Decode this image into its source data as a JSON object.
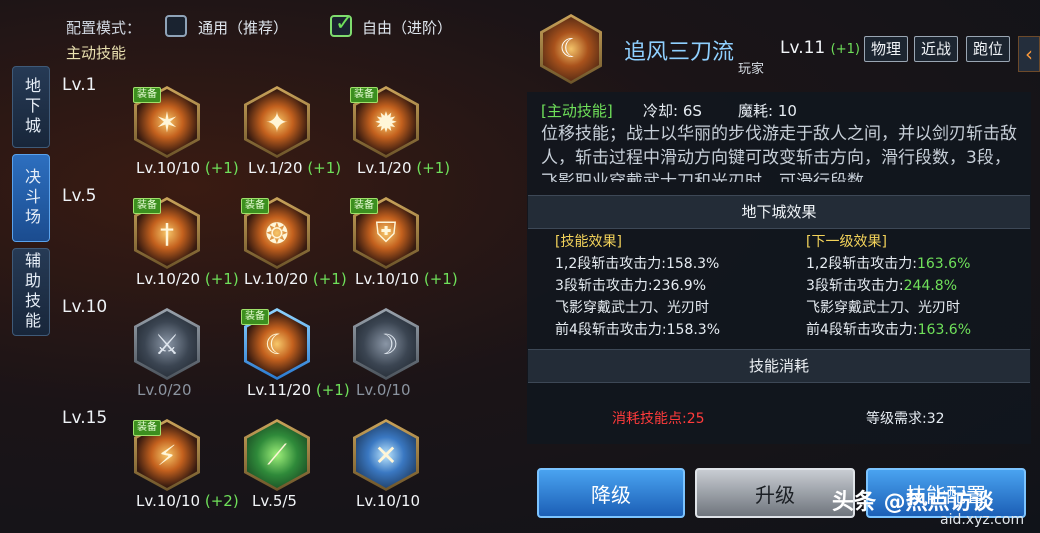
{
  "config": {
    "label": "配置模式：",
    "option_general": "通用（推荐）",
    "option_free": "自由（进阶）",
    "free_checked": true
  },
  "section_title": "主动技能",
  "tabs": [
    "地下城",
    "决斗场",
    "辅助技能"
  ],
  "levels": [
    "Lv.1",
    "Lv.5",
    "Lv.10",
    "Lv.15"
  ],
  "equip_badge": "装备",
  "skills": [
    {
      "lv": "Lv.10/10",
      "plus": "(+1)",
      "equipped": true,
      "icon": "claw-slash-icon"
    },
    {
      "lv": "Lv.1/20",
      "plus": "(+1)",
      "equipped": false,
      "icon": "sword-wave-icon"
    },
    {
      "lv": "Lv.1/20",
      "plus": "(+1)",
      "equipped": true,
      "icon": "flame-slash-icon"
    },
    {
      "lv": "Lv.10/20",
      "plus": "(+1)",
      "equipped": true,
      "icon": "sword-burst-icon"
    },
    {
      "lv": "Lv.10/20",
      "plus": "(+1)",
      "equipped": true,
      "icon": "spin-slash-icon"
    },
    {
      "lv": "Lv.10/10",
      "plus": "(+1)",
      "equipped": true,
      "icon": "shield-sword-icon"
    },
    {
      "lv": "Lv.0/20",
      "plus": "",
      "equipped": false,
      "icon": "dash-sword-icon"
    },
    {
      "lv": "Lv.11/20",
      "plus": "(+1)",
      "equipped": true,
      "icon": "triple-slash-icon"
    },
    {
      "lv": "Lv.0/10",
      "plus": "",
      "equipped": false,
      "icon": "moon-crest-icon"
    },
    {
      "lv": "Lv.10/10",
      "plus": "(+2)",
      "equipped": true,
      "icon": "warrior-strike-icon"
    },
    {
      "lv": "Lv.5/5",
      "plus": "",
      "equipped": false,
      "icon": "green-blade-icon"
    },
    {
      "lv": "Lv.10/10",
      "plus": "",
      "equipped": false,
      "icon": "cross-swords-icon"
    }
  ],
  "detail": {
    "name": "追风三刀流",
    "player": "玩家",
    "level": "Lv.11",
    "level_plus": "(+1)",
    "tags": [
      "物理",
      "近战",
      "跑位"
    ],
    "type_label": "[主动技能]",
    "cooldown": "冷却: 6S",
    "mana": "魔耗: 10",
    "description": "位移技能；战士以华丽的步伐游走于敌人之间，并以剑刃斩击敌人，斩击过程中滑动方向键可改变斩击方向，滑行段数，3段，飞影职业穿戴武士刀和光刃时，可滑行段数",
    "dungeon_effect": "地下城效果",
    "cur_title": "[技能效果]",
    "next_title": "[下一级效果]",
    "cur": [
      "1,2段斩击攻击力:158.3%",
      "3段斩击攻击力:236.9%",
      "飞影穿戴武士刀、光刃时",
      "前4段斩击攻击力:158.3%"
    ],
    "next": [
      {
        "label": "1,2段斩击攻击力:",
        "value": "163.6%"
      },
      {
        "label": "3段斩击攻击力:",
        "value": "244.8%"
      },
      {
        "label": "飞影穿戴武士刀、光刃时",
        "value": ""
      },
      {
        "label": "前4段斩击攻击力:",
        "value": "163.6%"
      }
    ],
    "cost_title": "技能消耗",
    "cost_sp": "消耗技能点:25",
    "req_level": "等级需求:32"
  },
  "buttons": {
    "downgrade": "降级",
    "upgrade": "升级",
    "config": "技能配置"
  },
  "watermark": {
    "main": "头条 @热点访谈",
    "sub": "aid.xyz.com"
  }
}
